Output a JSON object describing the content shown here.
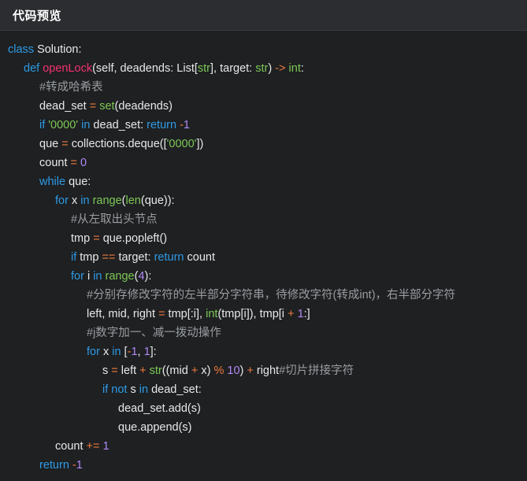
{
  "header": {
    "title": "代码预览"
  },
  "code_lines": [
    {
      "indent": 0,
      "tokens": [
        [
          "kw",
          "class"
        ],
        [
          "pl",
          " Solution:"
        ]
      ]
    },
    {
      "indent": 1,
      "tokens": [
        [
          "kw",
          "def"
        ],
        [
          "pl",
          " "
        ],
        [
          "fn",
          "openLock"
        ],
        [
          "pl",
          "(self, deadends: List["
        ],
        [
          "bi",
          "str"
        ],
        [
          "pl",
          "], target: "
        ],
        [
          "bi",
          "str"
        ],
        [
          "pl",
          ") "
        ],
        [
          "op",
          "->"
        ],
        [
          "pl",
          " "
        ],
        [
          "bi",
          "int"
        ],
        [
          "pl",
          ":"
        ]
      ]
    },
    {
      "indent": 2,
      "tokens": [
        [
          "cm",
          "#转成哈希表"
        ]
      ]
    },
    {
      "indent": 2,
      "tokens": [
        [
          "pl",
          "dead_set "
        ],
        [
          "op",
          "="
        ],
        [
          "pl",
          " "
        ],
        [
          "bi",
          "set"
        ],
        [
          "pl",
          "(deadends)"
        ]
      ]
    },
    {
      "indent": 2,
      "tokens": [
        [
          "kw",
          "if"
        ],
        [
          "pl",
          " "
        ],
        [
          "str",
          "'0000'"
        ],
        [
          "pl",
          " "
        ],
        [
          "kw",
          "in"
        ],
        [
          "pl",
          " dead_set: "
        ],
        [
          "kw",
          "return"
        ],
        [
          "pl",
          " "
        ],
        [
          "op",
          "-"
        ],
        [
          "num",
          "1"
        ]
      ]
    },
    {
      "indent": 2,
      "tokens": [
        [
          "pl",
          "que "
        ],
        [
          "op",
          "="
        ],
        [
          "pl",
          " collections.deque(["
        ],
        [
          "str",
          "'0000'"
        ],
        [
          "pl",
          "])"
        ]
      ]
    },
    {
      "indent": 2,
      "tokens": [
        [
          "pl",
          "count "
        ],
        [
          "op",
          "="
        ],
        [
          "pl",
          " "
        ],
        [
          "num",
          "0"
        ]
      ]
    },
    {
      "indent": 2,
      "tokens": [
        [
          "kw",
          "while"
        ],
        [
          "pl",
          " que:"
        ]
      ]
    },
    {
      "indent": 3,
      "tokens": [
        [
          "kw",
          "for"
        ],
        [
          "pl",
          " x "
        ],
        [
          "kw",
          "in"
        ],
        [
          "pl",
          " "
        ],
        [
          "bi",
          "range"
        ],
        [
          "pl",
          "("
        ],
        [
          "bi",
          "len"
        ],
        [
          "pl",
          "(que)):"
        ]
      ]
    },
    {
      "indent": 4,
      "tokens": [
        [
          "cm",
          "#从左取出头节点"
        ]
      ]
    },
    {
      "indent": 4,
      "tokens": [
        [
          "pl",
          "tmp "
        ],
        [
          "op",
          "="
        ],
        [
          "pl",
          " que.popleft()"
        ]
      ]
    },
    {
      "indent": 4,
      "tokens": [
        [
          "kw",
          "if"
        ],
        [
          "pl",
          " tmp "
        ],
        [
          "op",
          "=="
        ],
        [
          "pl",
          " target: "
        ],
        [
          "kw",
          "return"
        ],
        [
          "pl",
          " count"
        ]
      ]
    },
    {
      "indent": 4,
      "tokens": [
        [
          "kw",
          "for"
        ],
        [
          "pl",
          " i "
        ],
        [
          "kw",
          "in"
        ],
        [
          "pl",
          " "
        ],
        [
          "bi",
          "range"
        ],
        [
          "pl",
          "("
        ],
        [
          "num",
          "4"
        ],
        [
          "pl",
          "):"
        ]
      ]
    },
    {
      "indent": 5,
      "tokens": [
        [
          "cm",
          "#分别存修改字符的左半部分字符串，待修改字符(转成int)，右半部分字符"
        ]
      ]
    },
    {
      "indent": 5,
      "tokens": [
        [
          "pl",
          "left, mid, right "
        ],
        [
          "op",
          "="
        ],
        [
          "pl",
          " tmp[:i], "
        ],
        [
          "bi",
          "int"
        ],
        [
          "pl",
          "(tmp[i]), tmp[i "
        ],
        [
          "op",
          "+"
        ],
        [
          "pl",
          " "
        ],
        [
          "num",
          "1"
        ],
        [
          "pl",
          ":]"
        ]
      ]
    },
    {
      "indent": 5,
      "tokens": [
        [
          "cm",
          "#j数字加一、减一拨动操作"
        ]
      ]
    },
    {
      "indent": 5,
      "tokens": [
        [
          "kw",
          "for"
        ],
        [
          "pl",
          " x "
        ],
        [
          "kw",
          "in"
        ],
        [
          "pl",
          " ["
        ],
        [
          "op",
          "-"
        ],
        [
          "num",
          "1"
        ],
        [
          "pl",
          ", "
        ],
        [
          "num",
          "1"
        ],
        [
          "pl",
          "]:"
        ]
      ]
    },
    {
      "indent": 6,
      "tokens": [
        [
          "pl",
          "s "
        ],
        [
          "op",
          "="
        ],
        [
          "pl",
          " left "
        ],
        [
          "op",
          "+"
        ],
        [
          "pl",
          " "
        ],
        [
          "bi",
          "str"
        ],
        [
          "pl",
          "((mid "
        ],
        [
          "op",
          "+"
        ],
        [
          "pl",
          " x) "
        ],
        [
          "op",
          "%"
        ],
        [
          "pl",
          " "
        ],
        [
          "num",
          "10"
        ],
        [
          "pl",
          ") "
        ],
        [
          "op",
          "+"
        ],
        [
          "pl",
          " right"
        ],
        [
          "cm",
          "#切片拼接字符"
        ]
      ]
    },
    {
      "indent": 6,
      "tokens": [
        [
          "kw",
          "if"
        ],
        [
          "pl",
          " "
        ],
        [
          "kw",
          "not"
        ],
        [
          "pl",
          " s "
        ],
        [
          "kw",
          "in"
        ],
        [
          "pl",
          " dead_set:"
        ]
      ]
    },
    {
      "indent": 7,
      "tokens": [
        [
          "pl",
          "dead_set.add(s)"
        ]
      ]
    },
    {
      "indent": 7,
      "tokens": [
        [
          "pl",
          "que.append(s)"
        ]
      ]
    },
    {
      "indent": 3,
      "tokens": [
        [
          "pl",
          "count "
        ],
        [
          "op",
          "+="
        ],
        [
          "pl",
          " "
        ],
        [
          "num",
          "1"
        ]
      ]
    },
    {
      "indent": 2,
      "tokens": [
        [
          "kw",
          "return"
        ],
        [
          "pl",
          " "
        ],
        [
          "op",
          "-"
        ],
        [
          "num",
          "1"
        ]
      ]
    }
  ]
}
